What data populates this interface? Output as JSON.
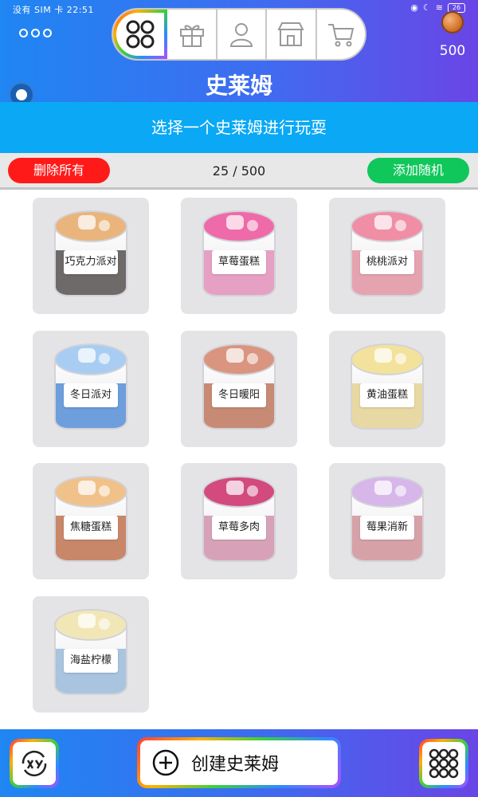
{
  "statusbar": {
    "left_text": "没有 SIM 卡 22:51",
    "battery": "26"
  },
  "header": {
    "title": "史莱姆",
    "coins": "500",
    "tabs": [
      {
        "icon": "grid-circles-icon",
        "active": true
      },
      {
        "icon": "gift-icon",
        "active": false
      },
      {
        "icon": "user-icon",
        "active": false
      },
      {
        "icon": "shop-icon",
        "active": false
      },
      {
        "icon": "cart-icon",
        "active": false
      }
    ]
  },
  "subheader": {
    "text": "选择一个史莱姆进行玩耍"
  },
  "actions": {
    "delete_all": "删除所有",
    "count": "25 / 500",
    "add_random": "添加随机"
  },
  "slimes": [
    {
      "label": "巧克力派对",
      "fill": "#6e6a6a",
      "top": "#e9b57c"
    },
    {
      "label": "草莓蛋糕",
      "fill": "#e6a0c3",
      "top": "#ee6aa8"
    },
    {
      "label": "桃桃派对",
      "fill": "#e5a3b0",
      "top": "#f08ea6"
    },
    {
      "label": "冬日派对",
      "fill": "#6e9edb",
      "top": "#a9cdf2"
    },
    {
      "label": "冬日暖阳",
      "fill": "#c78a74",
      "top": "#d99580"
    },
    {
      "label": "黄油蛋糕",
      "fill": "#e8d8a3",
      "top": "#f3e29b"
    },
    {
      "label": "焦糖蛋糕",
      "fill": "#c9876a",
      "top": "#f0c28a"
    },
    {
      "label": "草莓多肉",
      "fill": "#d7a2b7",
      "top": "#d24a7e"
    },
    {
      "label": "莓果消新",
      "fill": "#d6a2a8",
      "top": "#d7b6ea"
    },
    {
      "label": "海盐柠檬",
      "fill": "#a9c4df",
      "top": "#f1e7b6"
    }
  ],
  "bottom": {
    "create_label": "创建史莱姆"
  }
}
